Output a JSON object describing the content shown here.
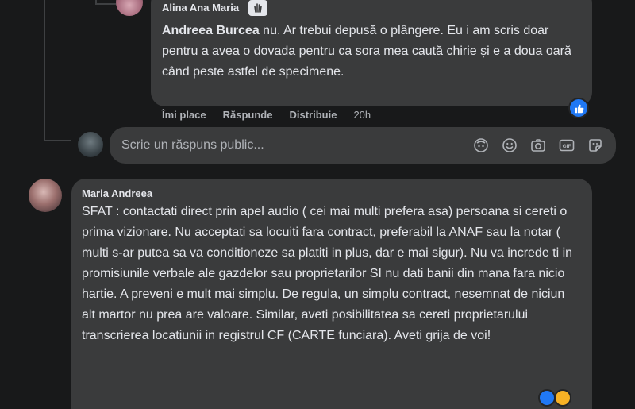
{
  "reply_comment": {
    "author": "Alina Ana Maria",
    "mention": "Andreea Burcea",
    "text": " nu. Ar trebui depusă o plângere. Eu i am scris doar pentru a avea o dovada pentru ca sora mea caută chirie și e a doua oară când peste astfel de specimene.",
    "actions": {
      "like": "Îmi place",
      "reply": "Răspunde",
      "share": "Distribuie",
      "time": "20h"
    },
    "reaction_icon": "like-reaction-icon"
  },
  "reply_box": {
    "placeholder": "Scrie un răspuns public...",
    "icons": [
      "avatar-sticker-icon",
      "emoji-icon",
      "camera-icon",
      "gif-icon",
      "sticker-icon"
    ]
  },
  "comment": {
    "author": "Maria Andreea",
    "text": "SFAT : contactati direct prin apel audio ( cei mai multi prefera asa) persoana si cereti o prima vizionare. Nu acceptati sa locuiti fara contract, preferabil la ANAF sau la notar ( multi s-ar putea sa va conditioneze sa platiti in plus, dar e mai sigur). Nu va increde ti in promisiunile verbale ale gazdelor sau proprietarilor SI nu dati banii din mana fara nicio hartie. A preveni e mult mai simplu. De regula, un simplu contract, nesemnat de niciun alt martor nu prea are valoare. Similar, aveti posibilitatea sa cereti proprietarului transcrierea locatiunii in registrul CF (CARTE funciara). Aveti grija de voi!"
  },
  "colors": {
    "background": "#18191a",
    "bubble": "#3a3b3c",
    "text": "#e4e6eb",
    "muted": "#b0b3b8",
    "like_blue": "#2078f4"
  }
}
